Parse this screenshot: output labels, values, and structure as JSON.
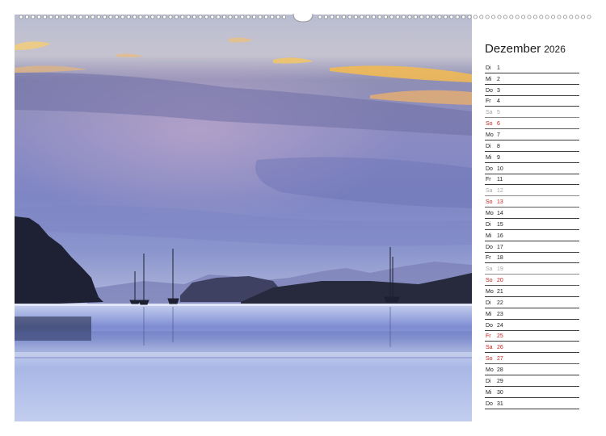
{
  "calendar": {
    "month": "Dezember",
    "year": "2026",
    "days": [
      {
        "dow": "Di",
        "day": "1",
        "type": "weekday"
      },
      {
        "dow": "Mi",
        "day": "2",
        "type": "weekday"
      },
      {
        "dow": "Do",
        "day": "3",
        "type": "weekday"
      },
      {
        "dow": "Fr",
        "day": "4",
        "type": "weekday"
      },
      {
        "dow": "Sa",
        "day": "5",
        "type": "sat"
      },
      {
        "dow": "So",
        "day": "6",
        "type": "sun"
      },
      {
        "dow": "Mo",
        "day": "7",
        "type": "weekday"
      },
      {
        "dow": "Di",
        "day": "8",
        "type": "weekday"
      },
      {
        "dow": "Mi",
        "day": "9",
        "type": "weekday"
      },
      {
        "dow": "Do",
        "day": "10",
        "type": "weekday"
      },
      {
        "dow": "Fr",
        "day": "11",
        "type": "weekday"
      },
      {
        "dow": "Sa",
        "day": "12",
        "type": "sat"
      },
      {
        "dow": "So",
        "day": "13",
        "type": "sun"
      },
      {
        "dow": "Mo",
        "day": "14",
        "type": "weekday"
      },
      {
        "dow": "Di",
        "day": "15",
        "type": "weekday"
      },
      {
        "dow": "Mi",
        "day": "16",
        "type": "weekday"
      },
      {
        "dow": "Do",
        "day": "17",
        "type": "weekday"
      },
      {
        "dow": "Fr",
        "day": "18",
        "type": "weekday"
      },
      {
        "dow": "Sa",
        "day": "19",
        "type": "sat"
      },
      {
        "dow": "So",
        "day": "20",
        "type": "sun"
      },
      {
        "dow": "Mo",
        "day": "21",
        "type": "weekday"
      },
      {
        "dow": "Di",
        "day": "22",
        "type": "weekday"
      },
      {
        "dow": "Mi",
        "day": "23",
        "type": "weekday"
      },
      {
        "dow": "Do",
        "day": "24",
        "type": "weekday"
      },
      {
        "dow": "Fr",
        "day": "25",
        "type": "hol"
      },
      {
        "dow": "Sa",
        "day": "26",
        "type": "hol"
      },
      {
        "dow": "So",
        "day": "27",
        "type": "sun"
      },
      {
        "dow": "Mo",
        "day": "28",
        "type": "weekday"
      },
      {
        "dow": "Di",
        "day": "29",
        "type": "weekday"
      },
      {
        "dow": "Mi",
        "day": "30",
        "type": "weekday"
      },
      {
        "dow": "Do",
        "day": "31",
        "type": "weekday"
      }
    ]
  },
  "colors": {
    "sunday": "#c8201c",
    "saturday": "#a6a6a6",
    "text": "#1a1a1a"
  }
}
